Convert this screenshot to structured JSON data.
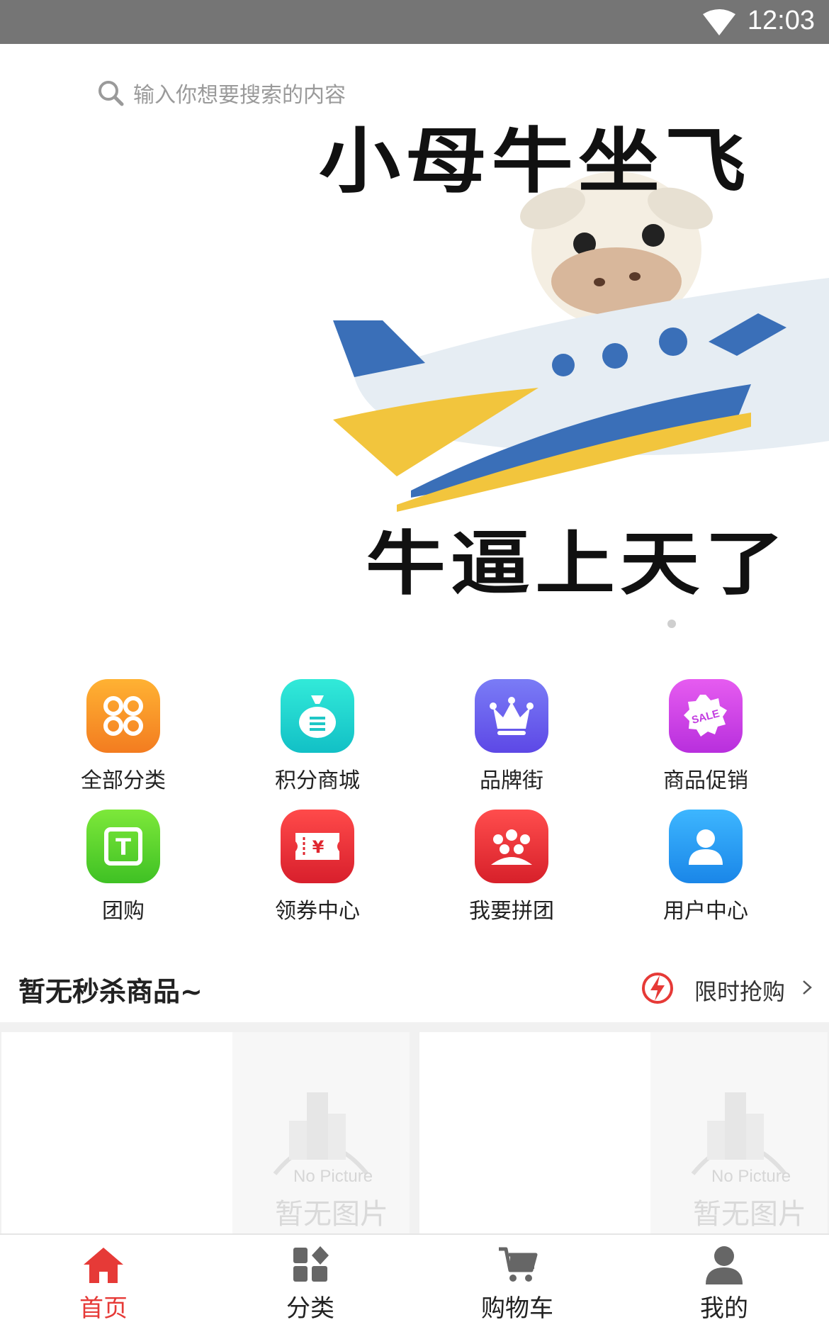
{
  "status_bar": {
    "time": "12:03"
  },
  "search": {
    "placeholder": "输入你想要搜索的内容"
  },
  "banner": {
    "line1": "小母牛坐飞",
    "line2": "牛逼上天了"
  },
  "quick_links": [
    {
      "label": "全部分类",
      "icon": "grid-icon",
      "color": "#f7932a"
    },
    {
      "label": "积分商城",
      "icon": "money-bag-icon",
      "color": "#1fd3c6"
    },
    {
      "label": "品牌街",
      "icon": "crown-icon",
      "color": "#6a5cf0"
    },
    {
      "label": "商品促销",
      "icon": "sale-tag-icon",
      "color": "#d243e6"
    },
    {
      "label": "团购",
      "icon": "group-buy-icon",
      "color": "#4fcf2a"
    },
    {
      "label": "领券中心",
      "icon": "coupon-icon",
      "color": "#e62e3a"
    },
    {
      "label": "我要拼团",
      "icon": "people-icon",
      "color": "#e8323a"
    },
    {
      "label": "用户中心",
      "icon": "user-icon",
      "color": "#1f9bf0"
    }
  ],
  "flash_sale": {
    "title": "暂无秒杀商品~",
    "link_label": "限时抢购"
  },
  "placeholder_image": {
    "en": "No Picture",
    "zh": "暂无图片"
  },
  "tabbar": [
    {
      "label": "首页",
      "icon": "home-icon",
      "active": true
    },
    {
      "label": "分类",
      "icon": "category-icon",
      "active": false
    },
    {
      "label": "购物车",
      "icon": "cart-icon",
      "active": false
    },
    {
      "label": "我的",
      "icon": "user-icon",
      "active": false
    }
  ],
  "colors": {
    "accent": "#e63a37",
    "status_bar": "#757575"
  }
}
